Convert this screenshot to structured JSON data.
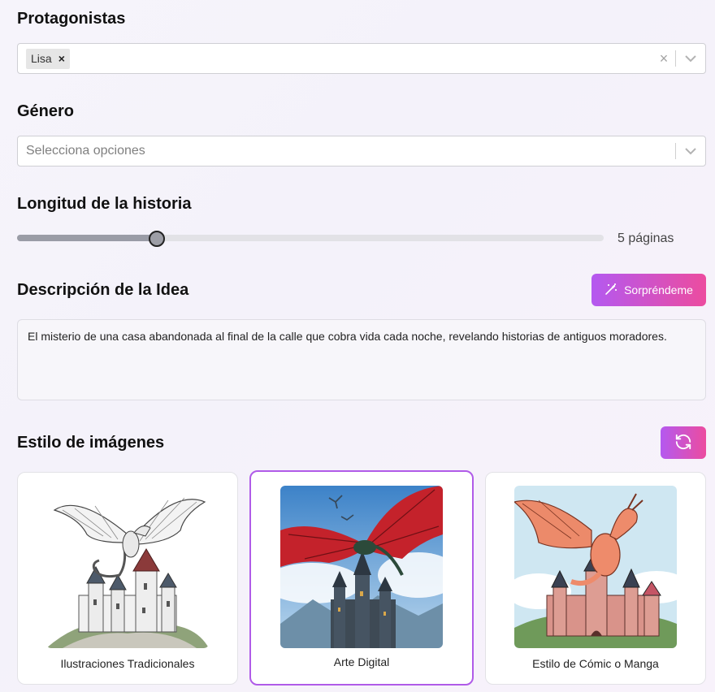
{
  "protagonists": {
    "title": "Protagonistas",
    "chips": [
      {
        "label": "Lisa",
        "remove": "×"
      }
    ],
    "clear": "×"
  },
  "genre": {
    "title": "Género",
    "placeholder": "Selecciona opciones"
  },
  "length": {
    "title": "Longitud de la historia",
    "value_label": "5 páginas",
    "fraction": 0.238
  },
  "idea": {
    "title": "Descripción de la Idea",
    "surprise_label": "Sorpréndeme",
    "text": "El misterio de una casa abandonada al final de la calle que cobra vida cada noche, revelando historias de antiguos moradores."
  },
  "style": {
    "title": "Estilo de imágenes",
    "refresh_icon": "refresh-icon",
    "options": [
      {
        "label": "Ilustraciones Tradicionales",
        "selected": false
      },
      {
        "label": "Arte Digital",
        "selected": true
      },
      {
        "label": "Estilo de Cómic o Manga",
        "selected": false
      }
    ]
  },
  "colors": {
    "accent_start": "#b459f0",
    "accent_end": "#ec4c9f",
    "selected_border": "#b05be8"
  }
}
